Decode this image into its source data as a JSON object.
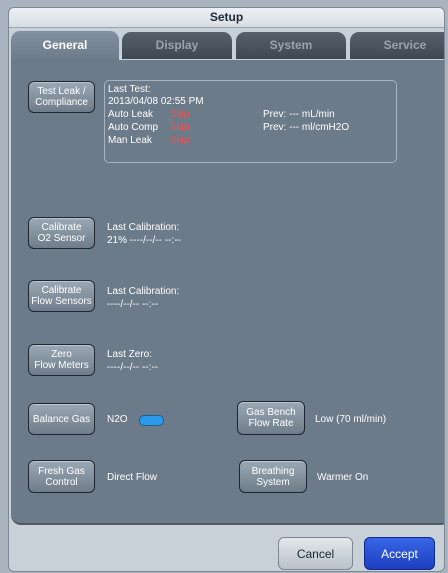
{
  "window": {
    "title": "Setup"
  },
  "tabs": [
    {
      "label": "General",
      "active": true
    },
    {
      "label": "Display",
      "active": false
    },
    {
      "label": "System",
      "active": false
    },
    {
      "label": "Service",
      "active": false
    }
  ],
  "leak_test": {
    "button": "Test Leak /\nCompliance",
    "last_test_label": "Last Test:",
    "last_test_datetime": "2013/04/08  02:55 PM",
    "auto_leak_label": "Auto Leak",
    "auto_leak_status": "Skip",
    "auto_comp_label": "Auto Comp",
    "auto_comp_status": "Skip",
    "man_leak_label": "Man Leak",
    "man_leak_status": "Skip",
    "prev_leak": "Prev: --- mL/min",
    "prev_comp": "Prev: --- ml/cmH2O"
  },
  "o2_sensor": {
    "button": "Calibrate\nO2 Sensor",
    "last_label": "Last Calibration:",
    "last_value": "21%   ----/--/--  --:--"
  },
  "flow_sensors": {
    "button": "Calibrate\nFlow Sensors",
    "last_label": "Last Calibration:",
    "last_value": "----/--/--  --:--"
  },
  "flow_meters": {
    "button": "Zero\nFlow Meters",
    "last_label": "Last Zero:",
    "last_value": "----/--/--  --:--"
  },
  "balance_gas": {
    "button": "Balance Gas",
    "value": "N2O",
    "toggle_color": "#2b9ae8"
  },
  "gas_bench": {
    "button": "Gas Bench\nFlow Rate",
    "value": "Low (70 ml/min)"
  },
  "fresh_gas": {
    "button": "Fresh Gas\nControl",
    "value": "Direct Flow"
  },
  "breathing": {
    "button": "Breathing\nSystem",
    "value": "Warmer On"
  },
  "footer": {
    "cancel": "Cancel",
    "accept": "Accept"
  },
  "colors": {
    "panel": "#6c7b8a",
    "skip": "#ff4a4a",
    "accept": "#2a52d6"
  }
}
